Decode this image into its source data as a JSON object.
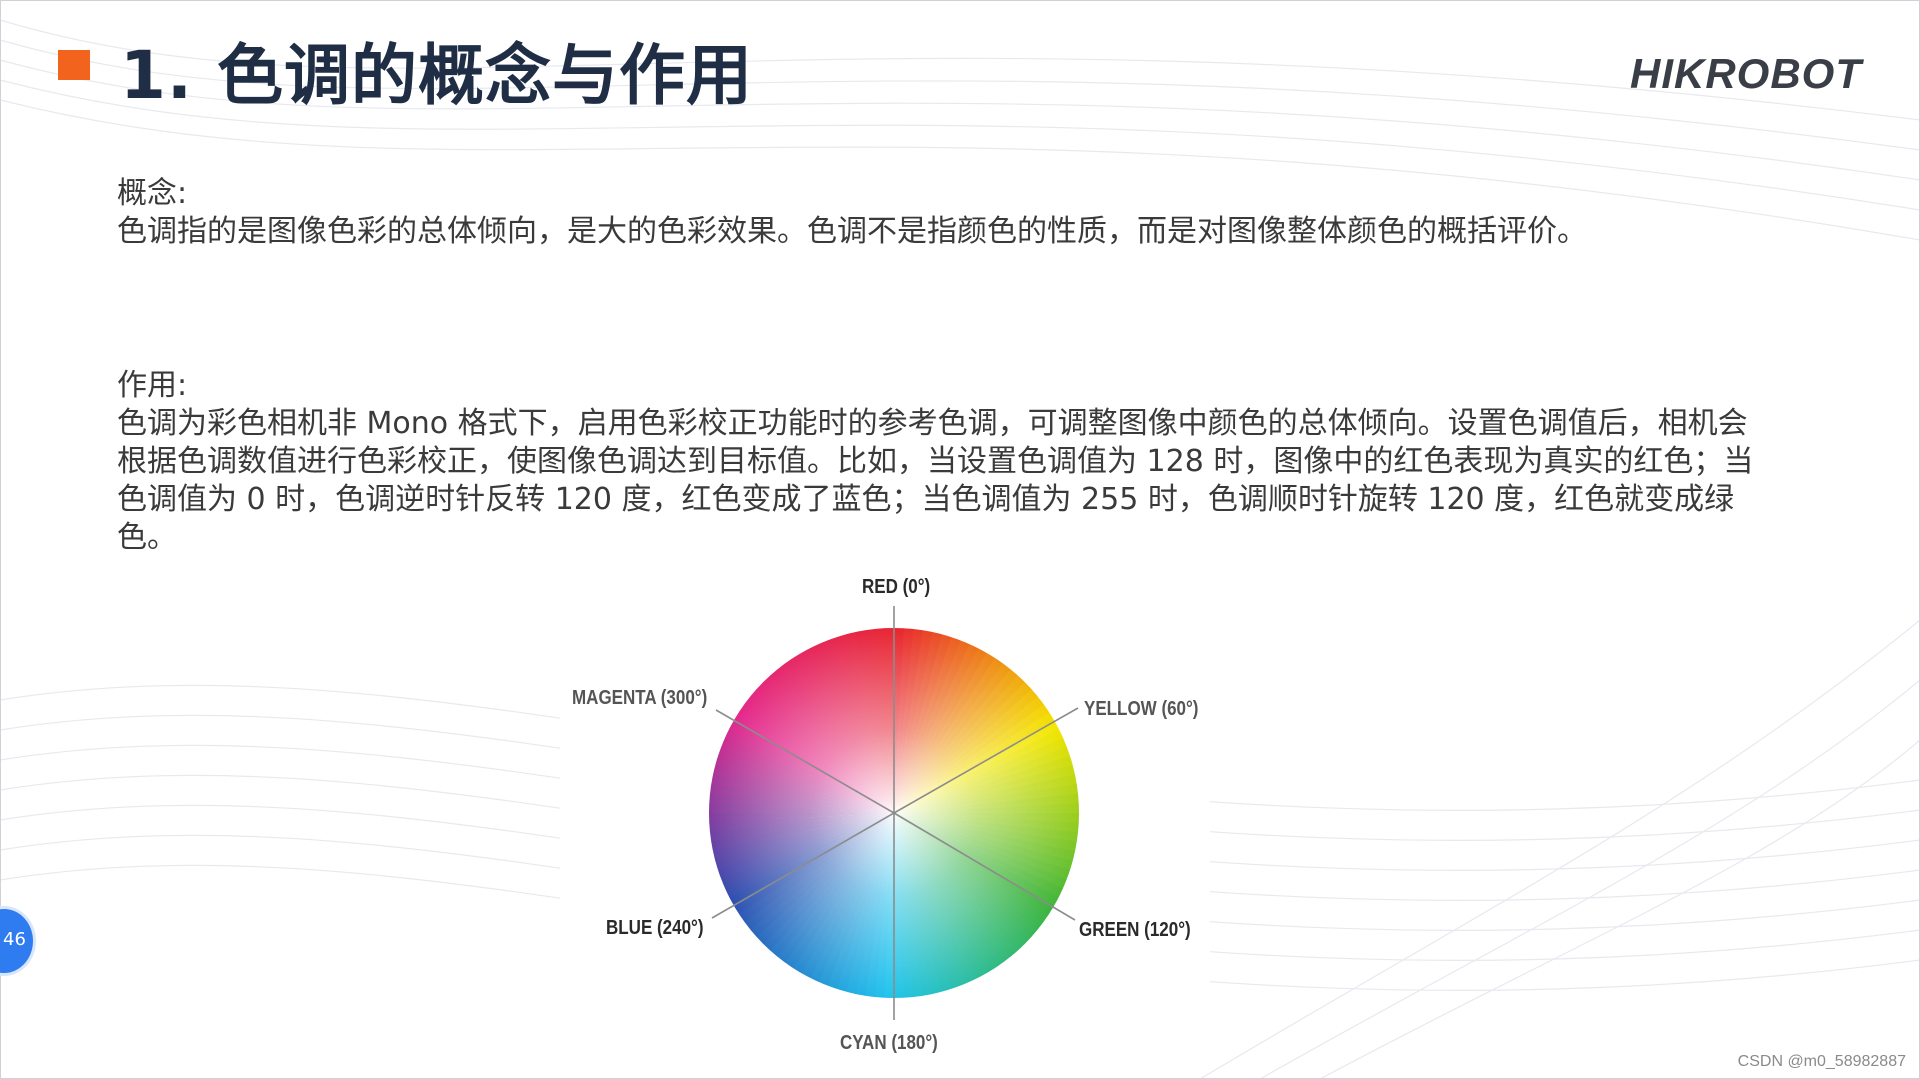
{
  "slide": {
    "title": "1. 色调的概念与作用",
    "logo_text": "HIKROBOT",
    "accent_color": "#f2631e",
    "title_color": "#1f2d45"
  },
  "concept": {
    "label": "概念:",
    "text": "色调指的是图像色彩的总体倾向，是大的色彩效果。色调不是指颜色的性质，而是对图像整体颜色的概括评价。"
  },
  "usage": {
    "label": "作用:",
    "text": "色调为彩色相机非 Mono 格式下，启用色彩校正功能时的参考色调，可调整图像中颜色的总体倾向。设置色调值后，相机会根据色调数值进行色彩校正，使图像色调达到目标值。比如，当设置色调值为 128 时，图像中的红色表现为真实的红色；当色调值为 0 时，色调逆时针反转 120 度，红色变成了蓝色；当色调值为 255 时，色调顺时针旋转 120 度，红色就变成绿色。"
  },
  "color_wheel": {
    "labels": {
      "red": "RED (0°)",
      "yellow": "YELLOW (60°)",
      "green": "GREEN (120°)",
      "cyan": "CYAN (180°)",
      "blue": "BLUE (240°)",
      "magenta": "MAGENTA (300°)"
    },
    "colors": {
      "red": "#e8262e",
      "yellow": "#f4e600",
      "green": "#3cb43c",
      "cyan": "#20c4ee",
      "blue": "#2f4fb0",
      "magenta": "#e4288c"
    }
  },
  "page_badge": "46",
  "watermark": "CSDN @m0_58982887"
}
